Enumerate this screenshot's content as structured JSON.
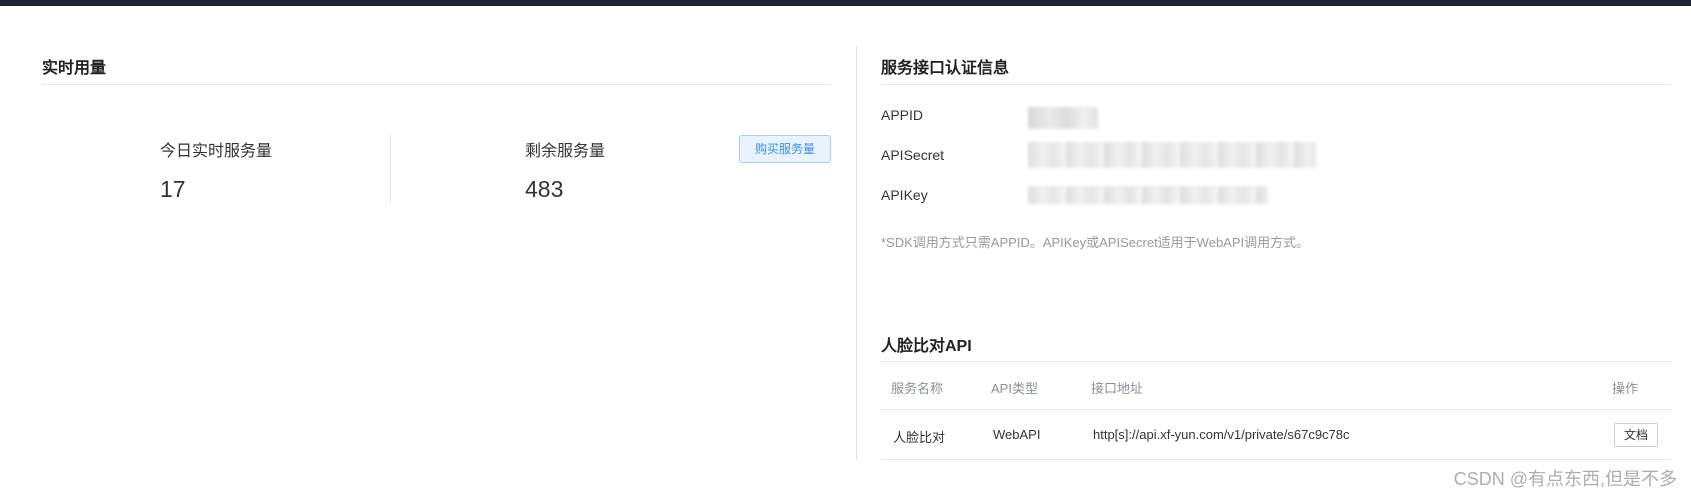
{
  "usage": {
    "title": "实时用量",
    "today": {
      "label": "今日实时服务量",
      "value": "17"
    },
    "remaining": {
      "label": "剩余服务量",
      "value": "483"
    },
    "buy_button": "购买服务量"
  },
  "auth": {
    "title": "服务接口认证信息",
    "fields": [
      {
        "label": "APPID"
      },
      {
        "label": "APISecret"
      },
      {
        "label": "APIKey"
      }
    ],
    "note": "*SDK调用方式只需APPID。APIKey或APISecret适用于WebAPI调用方式。"
  },
  "api": {
    "title": "人脸比对API",
    "columns": [
      "服务名称",
      "API类型",
      "接口地址",
      "操作"
    ],
    "rows": [
      {
        "name": "人脸比对",
        "type": "WebAPI",
        "url": "http[s]://api.xf-yun.com/v1/private/s67c9c78c",
        "action": "文档"
      }
    ]
  },
  "watermark": "CSDN @有点东西,但是不多"
}
